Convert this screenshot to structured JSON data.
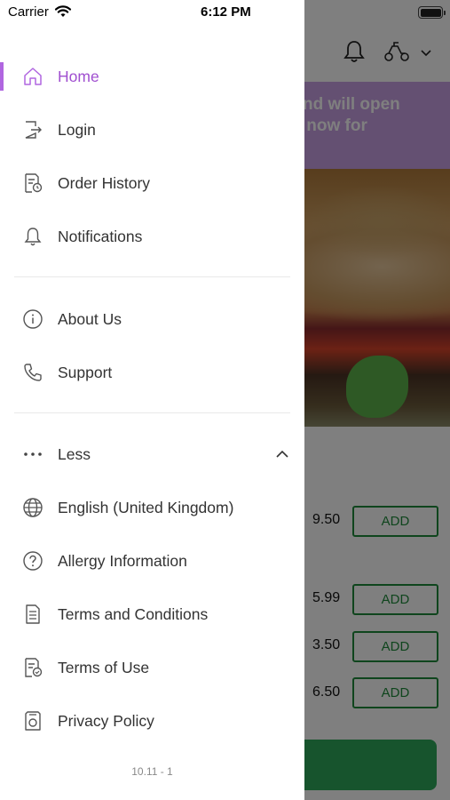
{
  "status_bar": {
    "carrier": "Carrier",
    "time": "6:12 PM"
  },
  "background": {
    "banner_lines": [
      "ed and will open",
      "rder now for"
    ],
    "items": [
      {
        "price": "9.50",
        "button": "ADD"
      },
      {
        "price": "5.99",
        "button": "ADD"
      },
      {
        "price": "3.50",
        "button": "ADD"
      },
      {
        "price": "6.50",
        "button": "ADD"
      }
    ],
    "accent_color": "#1f8a3a",
    "banner_color": "#c8a0e4"
  },
  "drawer": {
    "active_color": "#a04fd0",
    "items": [
      {
        "label": "Home",
        "icon": "home-icon"
      },
      {
        "label": "Login",
        "icon": "login-icon"
      },
      {
        "label": "Order History",
        "icon": "order-history-icon"
      },
      {
        "label": "Notifications",
        "icon": "bell-icon"
      },
      {
        "label": "About Us",
        "icon": "info-icon"
      },
      {
        "label": "Support",
        "icon": "phone-icon"
      },
      {
        "label": "Less",
        "icon": "more-dots-icon"
      },
      {
        "label": "English (United Kingdom)",
        "icon": "globe-icon"
      },
      {
        "label": "Allergy Information",
        "icon": "question-icon"
      },
      {
        "label": "Terms and Conditions",
        "icon": "document-icon"
      },
      {
        "label": "Terms of Use",
        "icon": "document-check-icon"
      },
      {
        "label": "Privacy Policy",
        "icon": "privacy-icon"
      }
    ],
    "version": "10.11 - 1"
  }
}
